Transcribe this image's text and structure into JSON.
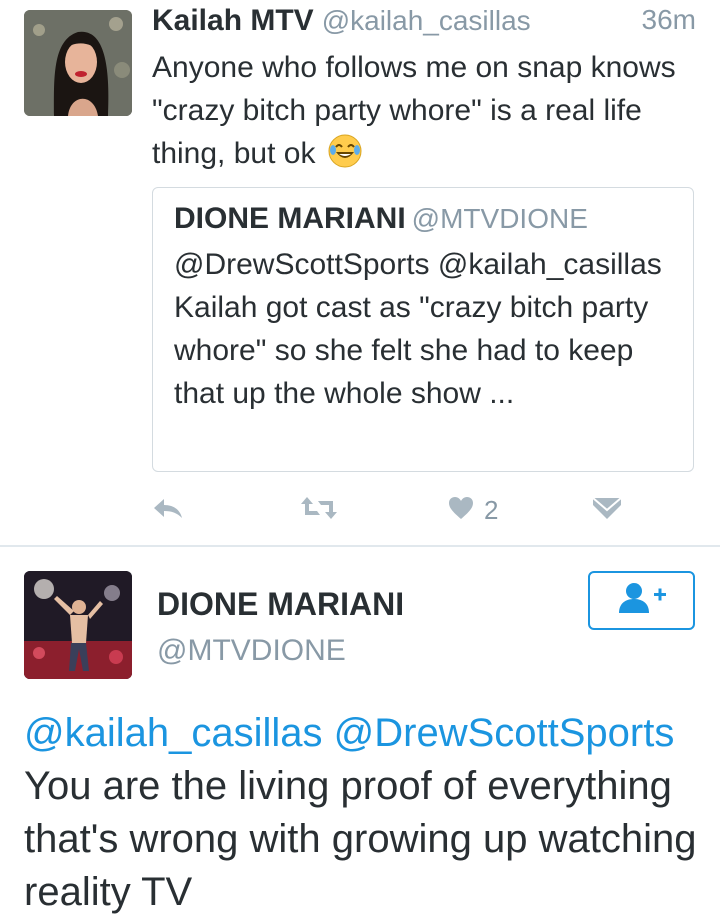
{
  "tweet": {
    "author_name": "Kailah MTV",
    "author_handle": "@kailah_casillas",
    "time": "36m",
    "text": "Anyone who follows me on snap knows \"crazy bitch party whore\" is a real life thing, but ok",
    "emoji": "laughing-tears-emoji",
    "quoted": {
      "author_name": "DIONE MARIANI",
      "author_handle": "@MTVDIONE",
      "text": "@DrewScottSports @kailah_casillas Kailah got cast as \"crazy bitch party whore\" so she felt she had to keep that up the whole show ..."
    },
    "actions": {
      "reply_icon": "reply-icon",
      "retweet_icon": "retweet-icon",
      "like_icon": "heart-icon",
      "like_count": "2",
      "dm_icon": "envelope-icon"
    }
  },
  "reply": {
    "author_name": "DIONE MARIANI",
    "author_handle": "@MTVDIONE",
    "follow_icon": "add-user-icon",
    "mention_1": "@kailah_casillas",
    "mention_2": "@DrewScottSports",
    "text": "You are the living proof of everything that's wrong with growing up watching reality TV"
  },
  "colors": {
    "accent": "#1b95e0",
    "text": "#292f33",
    "secondary": "#8899a6",
    "icon": "#aab8c2"
  }
}
